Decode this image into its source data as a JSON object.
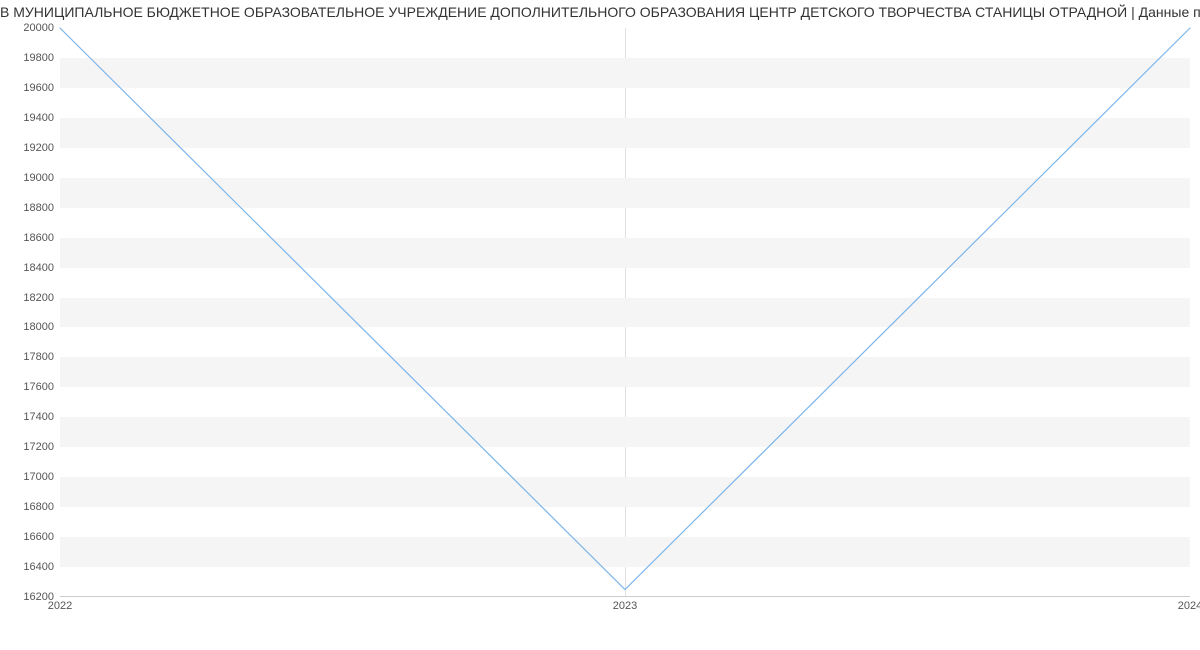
{
  "chart_data": {
    "type": "line",
    "title": "В МУНИЦИПАЛЬНОЕ БЮДЖЕТНОЕ ОБРАЗОВАТЕЛЬНОЕ УЧРЕЖДЕНИЕ ДОПОЛНИТЕЛЬНОГО ОБРАЗОВАНИЯ ЦЕНТР ДЕТСКОГО ТВОРЧЕСТВА СТАНИЦЫ ОТРАДНОЙ | Данные п",
    "x": [
      2022,
      2023,
      2024
    ],
    "values": [
      20000,
      16250,
      20000
    ],
    "xlabel": "",
    "ylabel": "",
    "ylim": [
      16200,
      20000
    ],
    "y_ticks": [
      16200,
      16400,
      16600,
      16800,
      17000,
      17200,
      17400,
      17600,
      17800,
      18000,
      18200,
      18400,
      18600,
      18800,
      19000,
      19200,
      19400,
      19600,
      19800,
      20000
    ],
    "x_ticks": [
      2022,
      2023,
      2024
    ]
  }
}
